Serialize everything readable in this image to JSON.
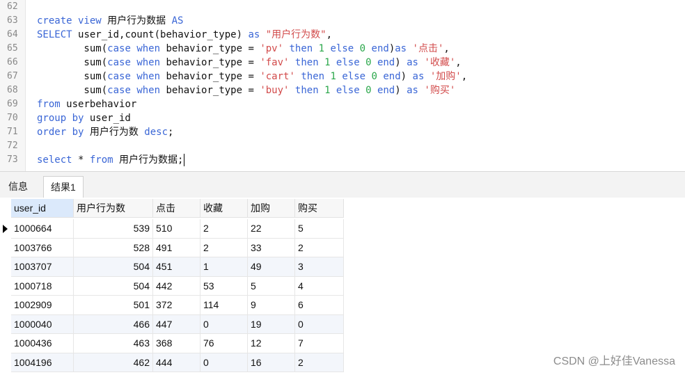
{
  "editor": {
    "lines": [
      {
        "no": "62",
        "parts": []
      },
      {
        "no": "63",
        "parts": [
          {
            "t": "create view ",
            "c": "kw"
          },
          {
            "t": "用户行为数据 ",
            "c": "tok-ident"
          },
          {
            "t": "AS",
            "c": "kw"
          }
        ]
      },
      {
        "no": "64",
        "parts": [
          {
            "t": "SELECT ",
            "c": "kw"
          },
          {
            "t": "user_id,count(behavior_type) ",
            "c": "tok-ident"
          },
          {
            "t": "as ",
            "c": "kw"
          },
          {
            "t": "\"用户行为数\"",
            "c": "str"
          },
          {
            "t": ",",
            "c": "tok-ident"
          }
        ]
      },
      {
        "no": "65",
        "parts": [
          {
            "t": "        sum(",
            "c": "tok-ident"
          },
          {
            "t": "case ",
            "c": "kw"
          },
          {
            "t": "when ",
            "c": "kw"
          },
          {
            "t": "behavior_type = ",
            "c": "tok-ident"
          },
          {
            "t": "'pv' ",
            "c": "str"
          },
          {
            "t": "then ",
            "c": "kw"
          },
          {
            "t": "1 ",
            "c": "num"
          },
          {
            "t": "else ",
            "c": "kw"
          },
          {
            "t": "0 ",
            "c": "num"
          },
          {
            "t": "end",
            "c": "kw"
          },
          {
            "t": ")",
            "c": "tok-ident"
          },
          {
            "t": "as ",
            "c": "kw"
          },
          {
            "t": "'点击'",
            "c": "str"
          },
          {
            "t": ",",
            "c": "tok-ident"
          }
        ]
      },
      {
        "no": "66",
        "parts": [
          {
            "t": "        sum(",
            "c": "tok-ident"
          },
          {
            "t": "case ",
            "c": "kw"
          },
          {
            "t": "when ",
            "c": "kw"
          },
          {
            "t": "behavior_type = ",
            "c": "tok-ident"
          },
          {
            "t": "'fav' ",
            "c": "str"
          },
          {
            "t": "then ",
            "c": "kw"
          },
          {
            "t": "1 ",
            "c": "num"
          },
          {
            "t": "else ",
            "c": "kw"
          },
          {
            "t": "0 ",
            "c": "num"
          },
          {
            "t": "end",
            "c": "kw"
          },
          {
            "t": ") ",
            "c": "tok-ident"
          },
          {
            "t": "as ",
            "c": "kw"
          },
          {
            "t": "'收藏'",
            "c": "str"
          },
          {
            "t": ",",
            "c": "tok-ident"
          }
        ]
      },
      {
        "no": "67",
        "parts": [
          {
            "t": "        sum(",
            "c": "tok-ident"
          },
          {
            "t": "case ",
            "c": "kw"
          },
          {
            "t": "when ",
            "c": "kw"
          },
          {
            "t": "behavior_type = ",
            "c": "tok-ident"
          },
          {
            "t": "'cart' ",
            "c": "str"
          },
          {
            "t": "then ",
            "c": "kw"
          },
          {
            "t": "1 ",
            "c": "num"
          },
          {
            "t": "else ",
            "c": "kw"
          },
          {
            "t": "0 ",
            "c": "num"
          },
          {
            "t": "end",
            "c": "kw"
          },
          {
            "t": ") ",
            "c": "tok-ident"
          },
          {
            "t": "as ",
            "c": "kw"
          },
          {
            "t": "'加购'",
            "c": "str"
          },
          {
            "t": ",",
            "c": "tok-ident"
          }
        ]
      },
      {
        "no": "68",
        "parts": [
          {
            "t": "        sum(",
            "c": "tok-ident"
          },
          {
            "t": "case ",
            "c": "kw"
          },
          {
            "t": "when ",
            "c": "kw"
          },
          {
            "t": "behavior_type = ",
            "c": "tok-ident"
          },
          {
            "t": "'buy' ",
            "c": "str"
          },
          {
            "t": "then ",
            "c": "kw"
          },
          {
            "t": "1 ",
            "c": "num"
          },
          {
            "t": "else ",
            "c": "kw"
          },
          {
            "t": "0 ",
            "c": "num"
          },
          {
            "t": "end",
            "c": "kw"
          },
          {
            "t": ") ",
            "c": "tok-ident"
          },
          {
            "t": "as ",
            "c": "kw"
          },
          {
            "t": "'购买'",
            "c": "str"
          }
        ]
      },
      {
        "no": "69",
        "parts": [
          {
            "t": "from ",
            "c": "kw"
          },
          {
            "t": "userbehavior",
            "c": "tok-ident"
          }
        ]
      },
      {
        "no": "70",
        "parts": [
          {
            "t": "group by ",
            "c": "kw"
          },
          {
            "t": "user_id",
            "c": "tok-ident"
          }
        ]
      },
      {
        "no": "71",
        "parts": [
          {
            "t": "order by ",
            "c": "kw"
          },
          {
            "t": "用户行为数 ",
            "c": "tok-ident"
          },
          {
            "t": "desc",
            "c": "kw"
          },
          {
            "t": ";",
            "c": "tok-ident"
          }
        ]
      },
      {
        "no": "72",
        "parts": []
      },
      {
        "no": "73",
        "parts": [
          {
            "t": "select ",
            "c": "kw"
          },
          {
            "t": "* ",
            "c": "tok-ident"
          },
          {
            "t": "from ",
            "c": "kw"
          },
          {
            "t": "用户行为数据;",
            "c": "tok-ident"
          }
        ]
      }
    ]
  },
  "tabs": [
    {
      "label": "信息",
      "active": false
    },
    {
      "label": "结果1",
      "active": true
    }
  ],
  "table": {
    "columns": [
      "user_id",
      "用户行为数",
      "点击",
      "收藏",
      "加购",
      "购买"
    ],
    "rows": [
      [
        "1000664",
        "539",
        "510",
        "2",
        "22",
        "5"
      ],
      [
        "1003766",
        "528",
        "491",
        "2",
        "33",
        "2"
      ],
      [
        "1003707",
        "504",
        "451",
        "1",
        "49",
        "3"
      ],
      [
        "1000718",
        "504",
        "442",
        "53",
        "5",
        "4"
      ],
      [
        "1002909",
        "501",
        "372",
        "114",
        "9",
        "6"
      ],
      [
        "1000040",
        "466",
        "447",
        "0",
        "19",
        "0"
      ],
      [
        "1000436",
        "463",
        "368",
        "76",
        "12",
        "7"
      ],
      [
        "1004196",
        "462",
        "444",
        "0",
        "16",
        "2"
      ]
    ]
  },
  "watermark": "CSDN @上好佳Vanessa",
  "colors": {
    "keyword": "#3a66d6",
    "string": "#d24b4b",
    "number": "#2aa74a",
    "selected_header": "#dbe9fb"
  }
}
